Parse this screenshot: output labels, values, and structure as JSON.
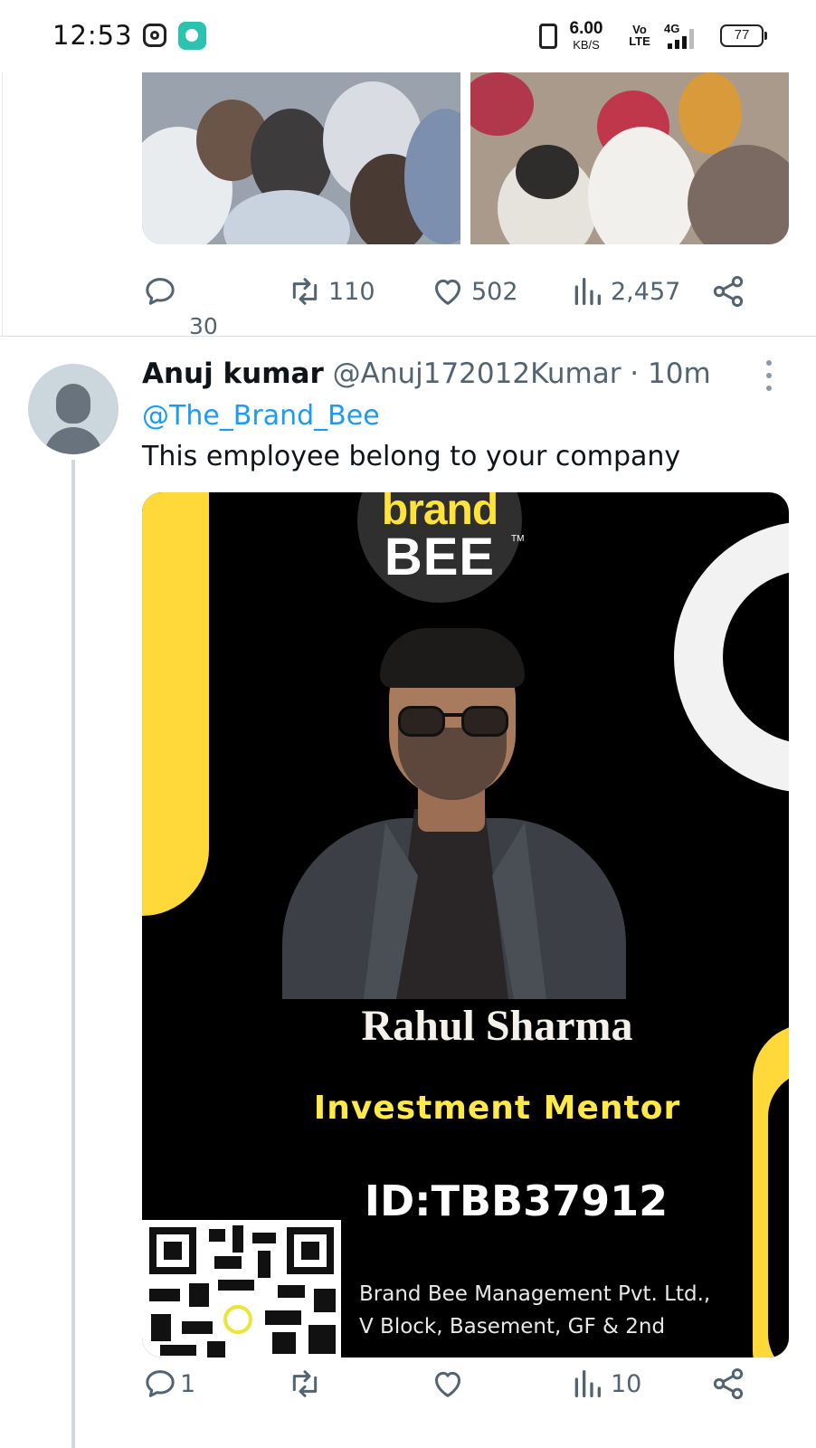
{
  "status_bar": {
    "time": "12:53",
    "speed_value": "6.00",
    "speed_unit": "KB/S",
    "volte": "Vo LTE",
    "network": "4G",
    "battery": "77",
    "icons": [
      "instagram-icon",
      "messenger-app-icon",
      "vibrate-icon",
      "signal-icon",
      "battery-icon"
    ]
  },
  "previous_tweet": {
    "actions": {
      "reply_count": "30",
      "retweet_count": "110",
      "like_count": "502",
      "view_count": "2,457"
    }
  },
  "tweet": {
    "author_name": "Anuj kumar",
    "author_handle": "@Anuj172012Kumar",
    "time": "· 10m",
    "mention": "@The_Brand_Bee",
    "text": "This employee belong to your company",
    "media": {
      "logo_brand": "brand",
      "logo_bee": "BEE",
      "logo_tm": "TM",
      "name": "Rahul Sharma",
      "role": "Investment Mentor",
      "id": "ID:TBB37912",
      "address_line1": "Brand Bee Management Pvt. Ltd.,",
      "address_line2": "V Block, Basement, GF & 2nd"
    },
    "actions": {
      "reply_count": "1",
      "retweet_count": "",
      "like_count": "",
      "view_count": "10"
    }
  },
  "colors": {
    "link_blue": "#1d9bf0",
    "secondary_text": "#536471",
    "brand_yellow": "#ffd83a"
  }
}
